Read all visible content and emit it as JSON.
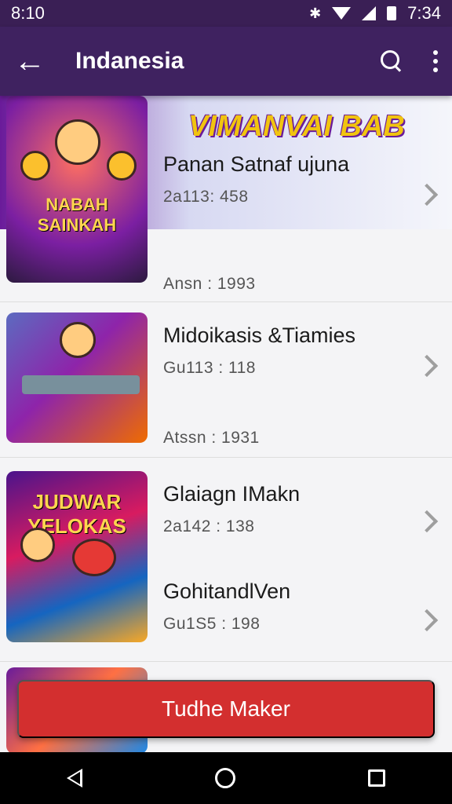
{
  "status": {
    "left_time": "8:10",
    "right_time": "7:34"
  },
  "appbar": {
    "title": "Indanesia"
  },
  "banner": {
    "text": "VIMANVAI BAB"
  },
  "items": [
    {
      "thumb_label": "NABAH SAINKAH",
      "name": "Panan Satnaf ujuna",
      "code": "2a113: 458",
      "footer": "Ansn : 1993"
    },
    {
      "thumb_label": "",
      "name": "Midoikasis &Tiamies",
      "code": "Gu113 : 118",
      "footer": "Atssn : 1931"
    },
    {
      "thumb_label": "JUDWAR YELOKAS",
      "name": "Glaiagn IMakn",
      "code": "2a142 : 138",
      "footer": ""
    },
    {
      "thumb_label": "",
      "name": "GohitandlVen",
      "code": "Gu1S5 : 198",
      "footer": ""
    }
  ],
  "cta": {
    "label": "Tudhe Maker"
  },
  "colors": {
    "appbar": "#3f2260",
    "cta": "#d32f2f",
    "navbar": "#000000"
  }
}
